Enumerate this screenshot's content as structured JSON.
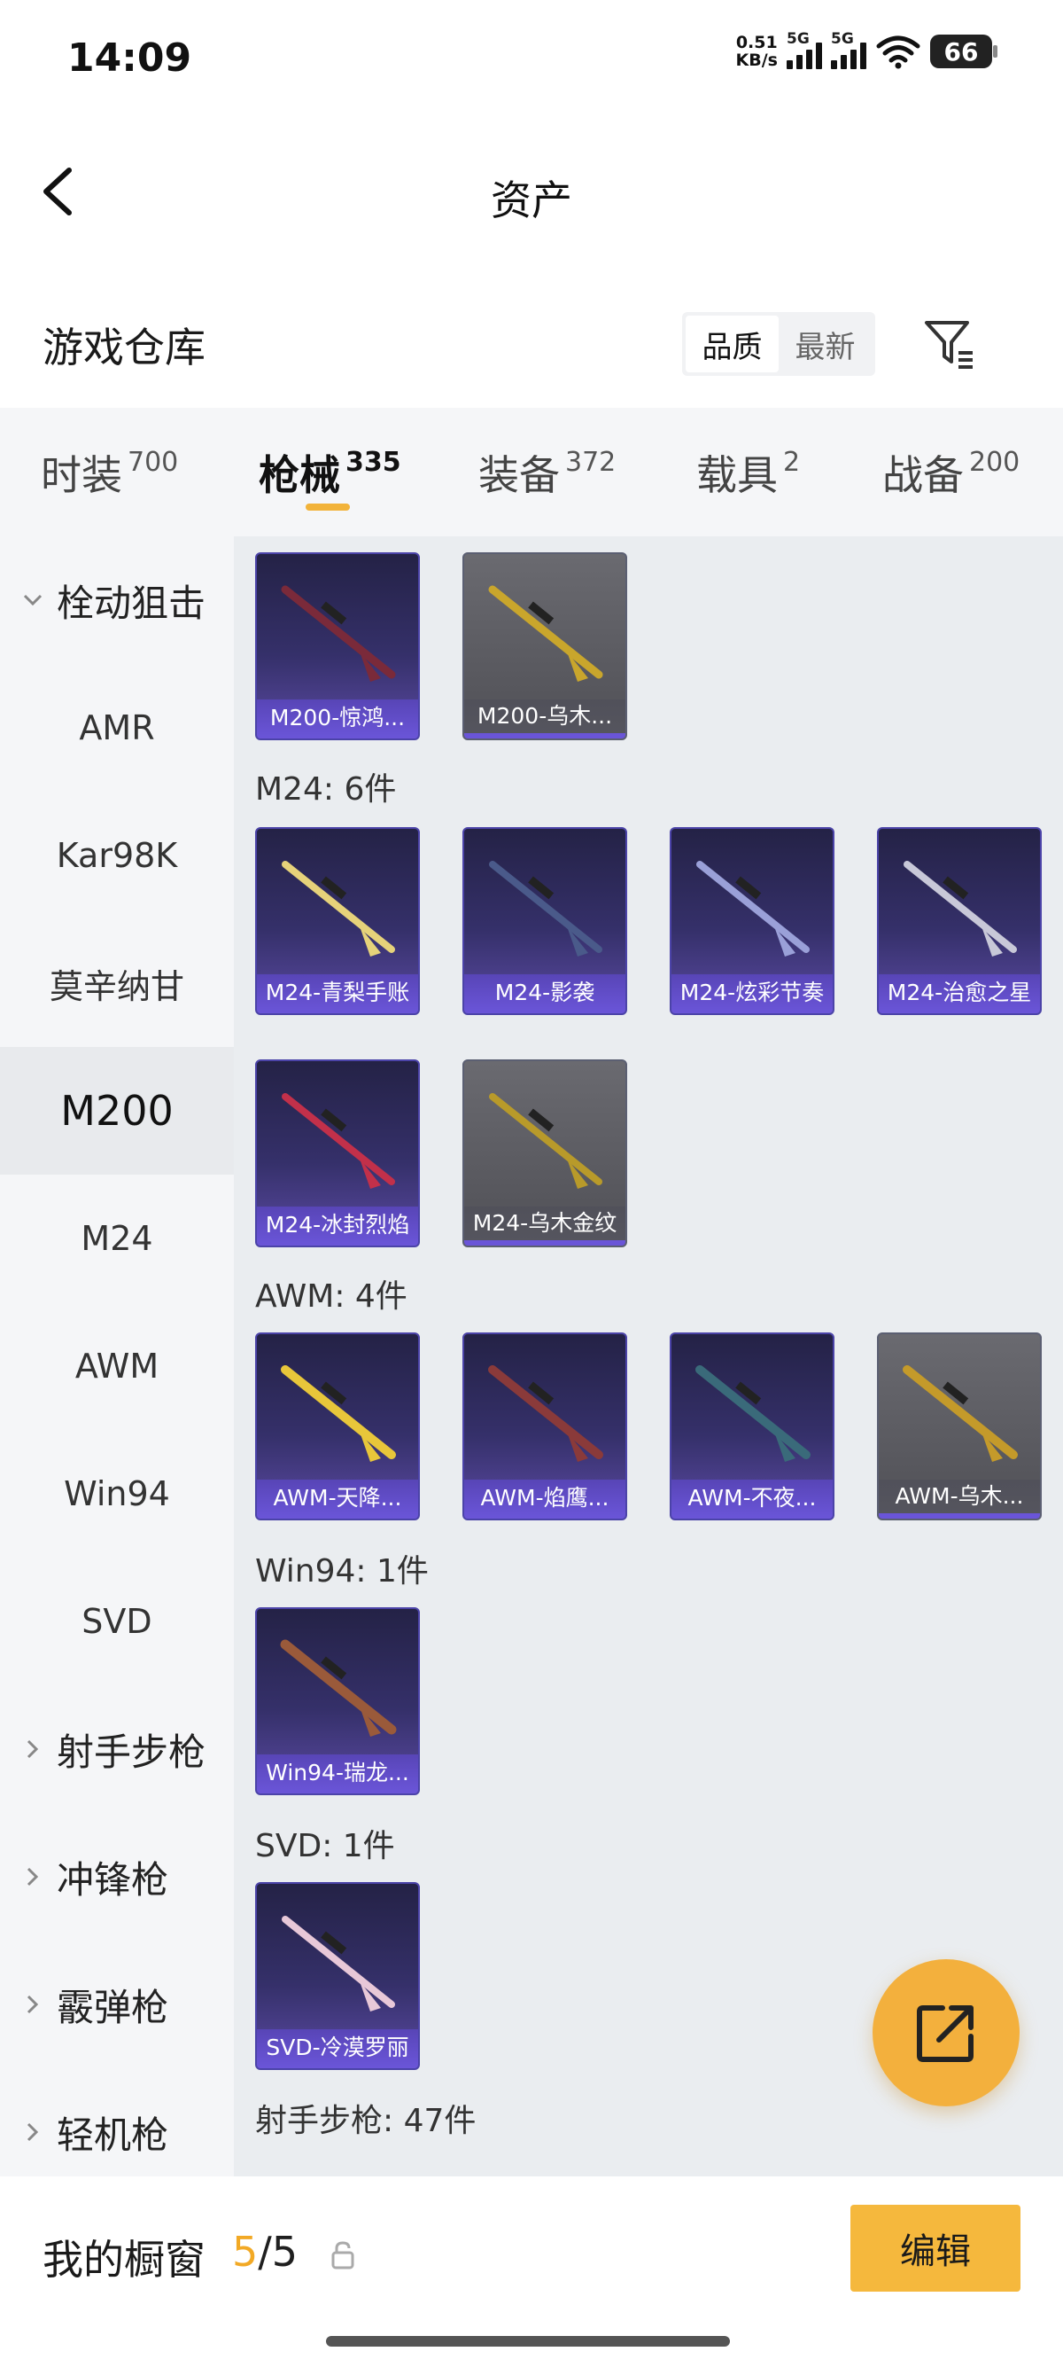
{
  "status_bar": {
    "time": "14:09",
    "net_speed_value": "0.51",
    "net_speed_unit": "KB/s",
    "sim1_label": "5G",
    "sim2_label": "5G",
    "battery": "66"
  },
  "header": {
    "title": "资产"
  },
  "section": {
    "title": "游戏仓库",
    "sort_options": [
      "品质",
      "最新"
    ],
    "sort_selected": "品质"
  },
  "tabs": [
    {
      "label": "时装",
      "count": "700"
    },
    {
      "label": "枪械",
      "count": "335",
      "active": true
    },
    {
      "label": "装备",
      "count": "372"
    },
    {
      "label": "载具",
      "count": "2"
    },
    {
      "label": "战备",
      "count": "200"
    }
  ],
  "sidebar": {
    "items": [
      {
        "label": "栓动狙击",
        "type": "group",
        "expanded": true
      },
      {
        "label": "AMR"
      },
      {
        "label": "Kar98K"
      },
      {
        "label": "莫辛纳甘"
      },
      {
        "label": "M200",
        "active": true
      },
      {
        "label": "M24"
      },
      {
        "label": "AWM"
      },
      {
        "label": "Win94"
      },
      {
        "label": "SVD"
      },
      {
        "label": "射手步枪",
        "type": "group"
      },
      {
        "label": "冲锋枪",
        "type": "group"
      },
      {
        "label": "霰弹枪",
        "type": "group"
      },
      {
        "label": "轻机枪",
        "type": "group"
      }
    ]
  },
  "content": {
    "groups": [
      {
        "label": "",
        "items": [
          {
            "name": "M200-惊鸿...",
            "style": "purple",
            "gun_color": "#7a2a3a"
          },
          {
            "name": "M200-乌木...",
            "style": "gray",
            "gun_color": "#c9a62c"
          }
        ]
      },
      {
        "label": "M24: 6件",
        "items": [
          {
            "name": "M24-青梨手账",
            "style": "purple",
            "gun_color": "#e6d27a"
          },
          {
            "name": "M24-影袭",
            "style": "purple",
            "gun_color": "#4a5a8a"
          },
          {
            "name": "M24-炫彩节奏",
            "style": "purple",
            "gun_color": "#9aa0d8"
          },
          {
            "name": "M24-治愈之星",
            "style": "purple",
            "gun_color": "#c8c8d8"
          },
          {
            "name": "M24-冰封烈焰",
            "style": "purple",
            "gun_color": "#c2304a"
          },
          {
            "name": "M24-乌木金纹",
            "style": "gray",
            "gun_color": "#b89a2a"
          }
        ]
      },
      {
        "label": "AWM: 4件",
        "items": [
          {
            "name": "AWM-天降...",
            "style": "purple",
            "gun_color": "#e8c63a"
          },
          {
            "name": "AWM-焰鹰...",
            "style": "purple",
            "gun_color": "#8a3a3a"
          },
          {
            "name": "AWM-不夜...",
            "style": "purple",
            "gun_color": "#3a6a7a"
          },
          {
            "name": "AWM-乌木...",
            "style": "gray",
            "gun_color": "#c49a2a"
          }
        ]
      },
      {
        "label": "Win94: 1件",
        "items": [
          {
            "name": "Win94-瑞龙...",
            "style": "purple",
            "gun_color": "#9a5a3a"
          }
        ]
      },
      {
        "label": "SVD: 1件",
        "items": [
          {
            "name": "SVD-冷漠罗丽",
            "style": "purple",
            "gun_color": "#e8c8d8"
          }
        ]
      },
      {
        "label": "射手步枪: 47件",
        "items": []
      }
    ]
  },
  "bottom_bar": {
    "showcase_label": "我的橱窗",
    "showcase_current": "5",
    "showcase_total": "/5",
    "edit_label": "编辑"
  },
  "colors": {
    "accent": "#f2b33a",
    "card_border": "#4b43a8",
    "card_label": "#6a55d8"
  }
}
